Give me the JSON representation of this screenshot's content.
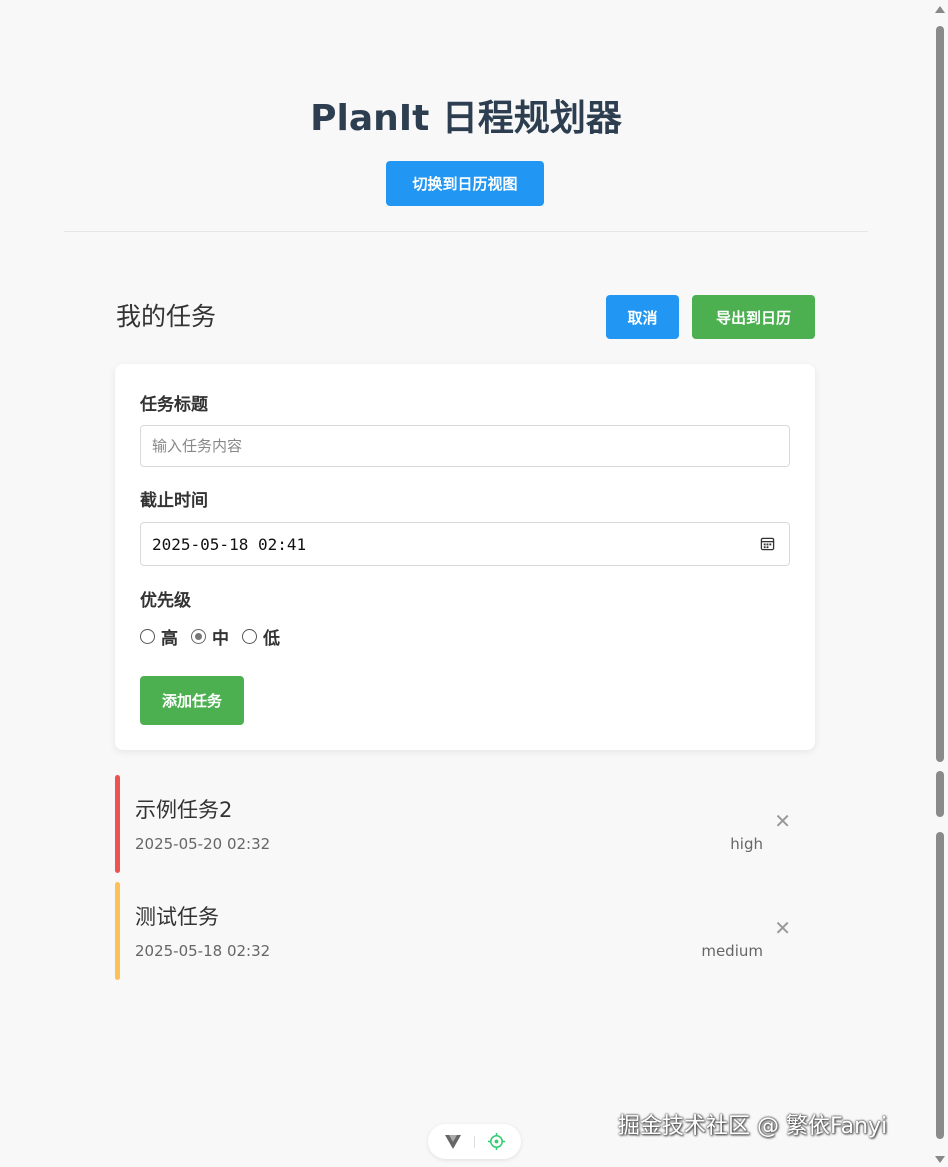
{
  "header": {
    "title": "PlanIt 日程规划器",
    "switch_view_label": "切换到日历视图"
  },
  "tasks_section": {
    "title": "我的任务",
    "cancel_label": "取消",
    "export_label": "导出到日历"
  },
  "form": {
    "title_label": "任务标题",
    "title_placeholder": "输入任务内容",
    "title_value": "",
    "deadline_label": "截止时间",
    "deadline_value": "2025-05-18 02:41",
    "priority_label": "优先级",
    "priority_options": [
      {
        "label": "高",
        "checked": false
      },
      {
        "label": "中",
        "checked": true
      },
      {
        "label": "低",
        "checked": false
      }
    ],
    "add_label": "添加任务"
  },
  "tasks": [
    {
      "title": "示例任务2",
      "date": "2025-05-20 02:32",
      "priority": "high",
      "color": "#ef5350",
      "delete_icon": "close-icon"
    },
    {
      "title": "测试任务",
      "date": "2025-05-18 02:32",
      "priority": "medium",
      "color": "#ffc05a",
      "delete_icon": "close-icon"
    }
  ],
  "colors": {
    "primary_blue": "#2196f3",
    "primary_green": "#4caf50",
    "background": "#f8f8f9"
  },
  "devtools": {
    "vue_icon": "vue-logo-icon",
    "inspect_icon": "target-icon"
  },
  "watermark": "掘金技术社区 @ 繁依Fanyi"
}
